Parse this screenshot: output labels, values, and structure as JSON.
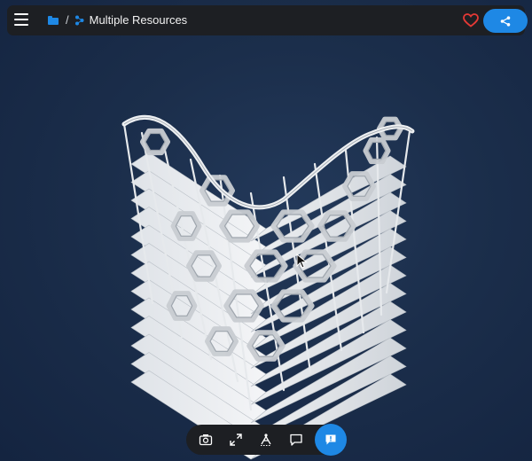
{
  "header": {
    "title": "Multiple Resources",
    "separator": "/",
    "menu_icon": "hamburger-menu-icon",
    "folder_icon": "folder-icon",
    "model_icon": "model-link-icon",
    "favorite_icon": "heart-outline-icon",
    "share_icon": "share-icon"
  },
  "viewer": {
    "content": "3d-building-model",
    "tools": [
      {
        "name": "screenshot",
        "icon": "camera-icon"
      },
      {
        "name": "fullscreen",
        "icon": "expand-icon"
      },
      {
        "name": "measure",
        "icon": "measure-icon"
      },
      {
        "name": "comments",
        "icon": "comment-icon"
      }
    ],
    "chat_icon": "chat-icon"
  },
  "colors": {
    "accent": "#1e88e5",
    "favorite": "#e53935",
    "bar_bg": "#1d1f23",
    "viewport_bg": "#1b2e4b"
  }
}
